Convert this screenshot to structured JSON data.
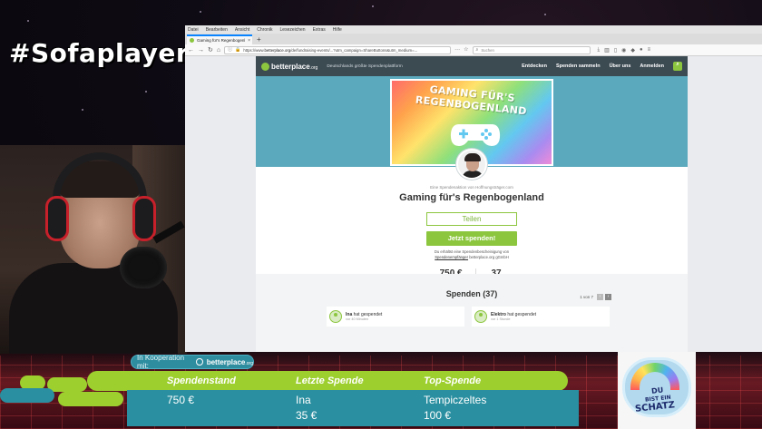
{
  "overlay": {
    "channel_tag": "#Sofaplayer",
    "cooperation_label": "In Kooperation mit:",
    "cooperation_logo": "betterplace",
    "cooperation_logo_suffix": ".org",
    "columns": [
      {
        "header": "Spendenstand",
        "values": [
          "750 €"
        ]
      },
      {
        "header": "Letzte Spende",
        "values": [
          "Ina",
          "35 €"
        ]
      },
      {
        "header": "Top-Spende",
        "values": [
          "Tempiczeltes",
          "100 €"
        ]
      }
    ],
    "sticker": {
      "line1": "DU",
      "line2": "BIST EIN",
      "line3": "SCHATZ"
    }
  },
  "browser": {
    "menu": [
      "Datei",
      "Bearbeiten",
      "Ansicht",
      "Chronik",
      "Lesezeichen",
      "Extras",
      "Hilfe"
    ],
    "tab_title": "Gaming für's Regenbogenland",
    "url_prefix": "https://www.",
    "url_domain": "betterplace.org",
    "url_path": "/de/fundraising-events/...?utm_campaign=ShareButtons&utm_medium=...",
    "search_placeholder": "Suchen"
  },
  "site": {
    "logo": "betterplace",
    "logo_suffix": ".org",
    "tagline": "Deutschlands größte Spendenplattform",
    "nav": [
      "Entdecken",
      "Spenden sammeln",
      "Über uns",
      "Anmelden"
    ],
    "banner_text": "GAMING FÜR'S REGENBOGENLAND",
    "byline": "Eine Spendenaktion von Hoffnungsträger.com",
    "title": "Gaming für's Regenbogenland",
    "share_button": "Teilen",
    "donate_button": "Jetzt spenden!",
    "receipt_line1": "Du erhältst eine Spendenbescheinigung von",
    "receipt_link": "Spendenempfänger",
    "receipt_line2": "betterplace.org gGmbH",
    "stats": [
      {
        "value": "750 €",
        "label": "gesammelt"
      },
      {
        "value": "37",
        "label": "Spenden"
      }
    ],
    "donations_title": "Spenden (37)",
    "pager_text": "1 von 7",
    "donations": [
      {
        "name": "Ina",
        "action": "hat gespendet",
        "time": "vor 40 Minuten"
      },
      {
        "name": "Elektro",
        "action": "hat gespendet",
        "time": "vor 1 Stunde"
      }
    ]
  },
  "colors": {
    "brand_green": "#8cc63f",
    "header_dark": "#3c4a52",
    "hero_teal": "#5ba9bd",
    "overlay_green": "#9dcf2e",
    "overlay_teal": "#2a8fa0"
  }
}
